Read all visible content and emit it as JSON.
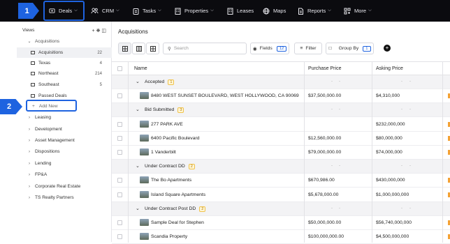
{
  "nav": {
    "items": [
      {
        "key": "deals",
        "label": "Deals",
        "icon": "deals-icon",
        "chevron": true
      },
      {
        "key": "crm",
        "label": "CRM",
        "icon": "people-icon",
        "chevron": true
      },
      {
        "key": "tasks",
        "label": "Tasks",
        "icon": "clipboard-icon",
        "chevron": true
      },
      {
        "key": "properties",
        "label": "Properties",
        "icon": "building-icon",
        "chevron": true
      },
      {
        "key": "leases",
        "label": "Leases",
        "icon": "building-icon",
        "chevron": false
      },
      {
        "key": "maps",
        "label": "Maps",
        "icon": "globe-icon",
        "chevron": false
      },
      {
        "key": "reports",
        "label": "Reports",
        "icon": "document-icon",
        "chevron": true
      },
      {
        "key": "more",
        "label": "More",
        "icon": "grid-icon",
        "chevron": true
      }
    ]
  },
  "callouts": {
    "step1": "1",
    "step2": "2"
  },
  "sidebar": {
    "views_label": "Views",
    "acquisitions": "Acquisitions",
    "views": [
      {
        "label": "Acquisitions",
        "count": "22",
        "active": true
      },
      {
        "label": "Texas",
        "count": "4"
      },
      {
        "label": "Northeast",
        "count": "214"
      },
      {
        "label": "Southeast",
        "count": "5"
      },
      {
        "label": "Passed Deals",
        "count": ""
      }
    ],
    "add_new": "Add New",
    "groups": [
      "Leasing",
      "Development",
      "Asset Management",
      "Dispositions",
      "Lending",
      "FP&A",
      "Corporate Real Estate",
      "TS Realty Partners"
    ]
  },
  "main": {
    "title": "Acquisitions",
    "search_placeholder": "Search",
    "fields_label": "Fields",
    "fields_count": "12",
    "filter_label": "Filter",
    "groupby_label": "Group By",
    "groupby_count": "1",
    "columns": {
      "name": "Name",
      "purchase": "Purchase Price",
      "asking": "Asking Price"
    },
    "dash": "-"
  },
  "rows": [
    {
      "type": "group",
      "label": "Accepted",
      "count": "1"
    },
    {
      "type": "item",
      "name": "8480 WEST SUNSET BOULEVARD, WEST HOLLYWOOD, CA 90069",
      "purchase": "$37,500,000.00",
      "asking": "$4,310,000"
    },
    {
      "type": "group",
      "label": "Bid Submitted",
      "count": "3"
    },
    {
      "type": "item",
      "name": "277 PARK AVE",
      "purchase": "",
      "asking": "$232,000,000"
    },
    {
      "type": "item",
      "name": "6400 Pacific Boulevard",
      "purchase": "$12,560,000.00",
      "asking": "$80,000,000"
    },
    {
      "type": "item",
      "name": "1 Vanderbilt",
      "purchase": "$79,000,000.00",
      "asking": "$74,000,000"
    },
    {
      "type": "group",
      "label": "Under Contract DD",
      "count": "2"
    },
    {
      "type": "item",
      "name": "The Bo Apartments",
      "purchase": "$670,986.00",
      "asking": "$430,000,000"
    },
    {
      "type": "item",
      "name": "Island Square Apartments",
      "purchase": "$5,678,000.00",
      "asking": "$1,000,000,000"
    },
    {
      "type": "group",
      "label": "Under Contract Post DD",
      "count": "2"
    },
    {
      "type": "item",
      "name": "Sample Deal for Stephen",
      "purchase": "$50,000,000.00",
      "asking": "$56,740,000,000"
    },
    {
      "type": "item",
      "name": "Scandia Property",
      "purchase": "$100,000,000.00",
      "asking": "$4,500,000,000"
    }
  ],
  "colors": {
    "accent": "#1e63e0",
    "topbar": "#0b0b0f",
    "group_badge": "#f0c24b"
  }
}
